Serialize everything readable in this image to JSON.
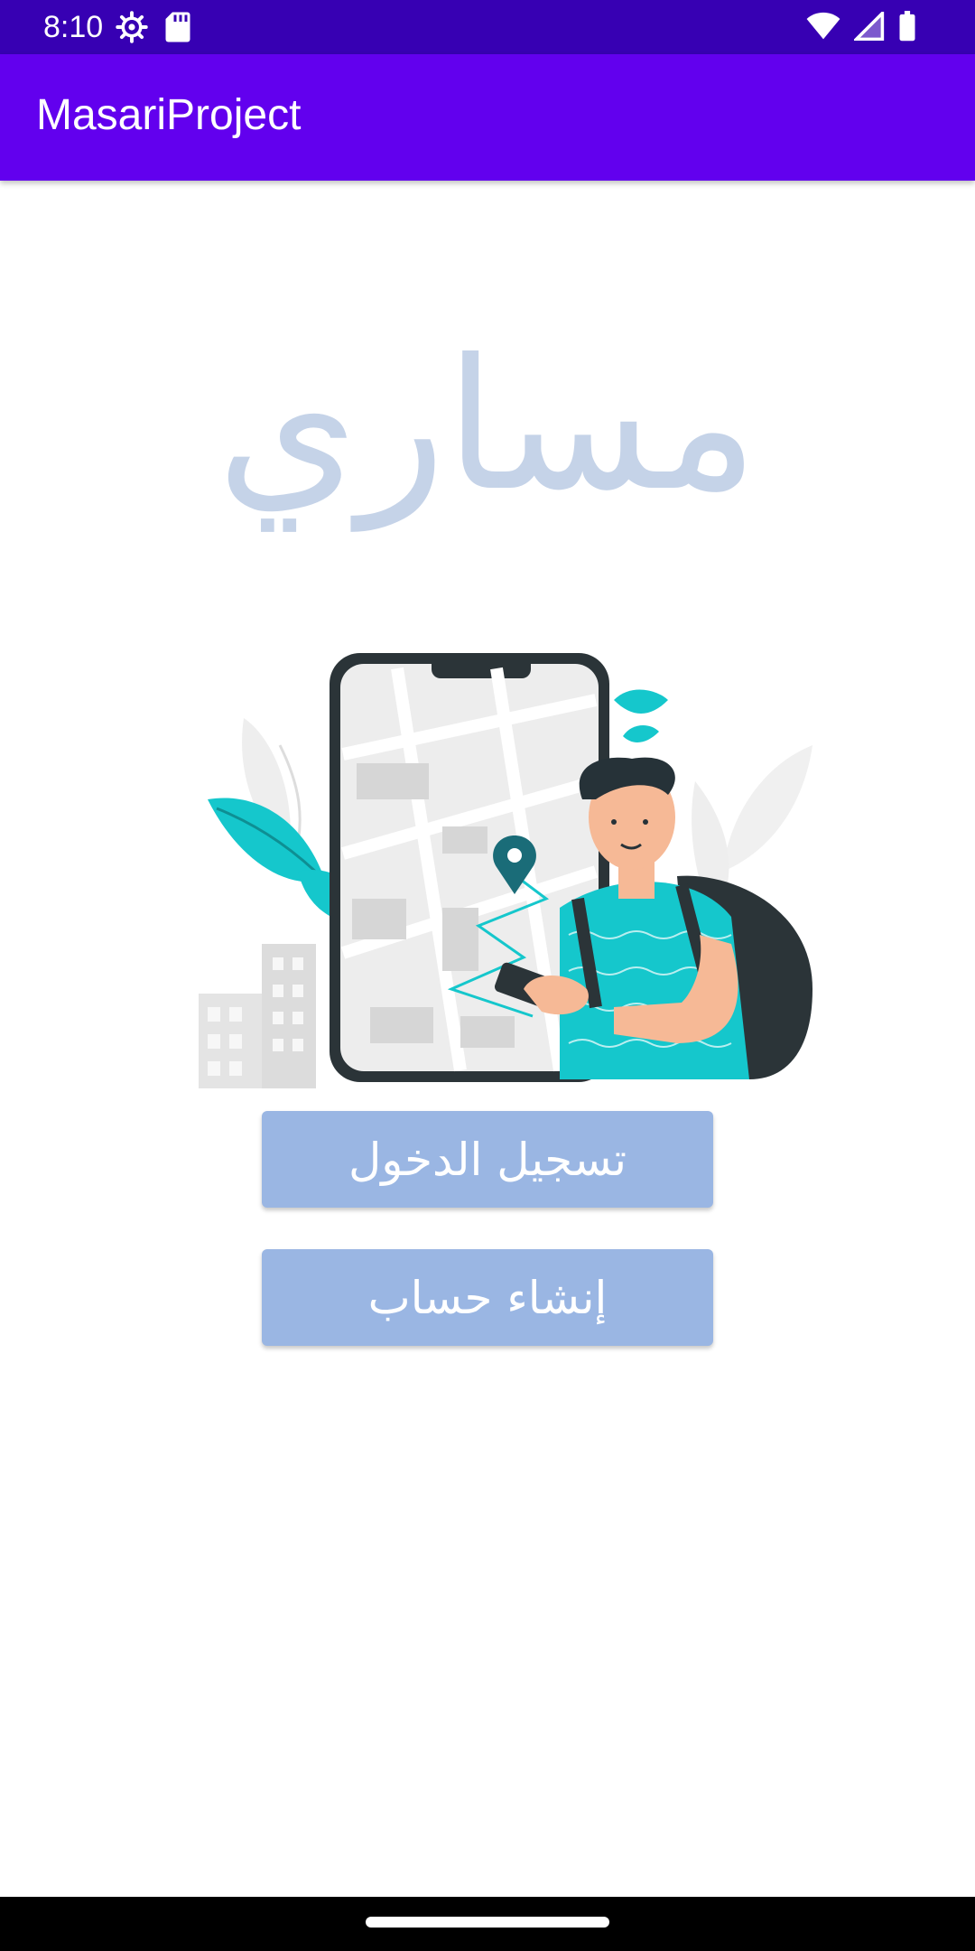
{
  "status_bar": {
    "time": "8:10",
    "left_icons": [
      "settings-icon",
      "sd-card-icon"
    ],
    "right_icons": [
      "wifi-icon",
      "cell-signal-icon",
      "battery-icon"
    ],
    "background": "#3700b3"
  },
  "app_bar": {
    "title": "MasariProject",
    "background": "#6200ee"
  },
  "logo": {
    "text": "مساري",
    "color": "#c5d3e8"
  },
  "illustration": {
    "name": "person-with-phone-map-illustration"
  },
  "buttons": {
    "login_label": "تسجيل الدخول",
    "signup_label": "إنشاء حساب",
    "background": "#9ab6e3"
  },
  "nav_bar": {
    "home_indicator": "home-pill"
  }
}
